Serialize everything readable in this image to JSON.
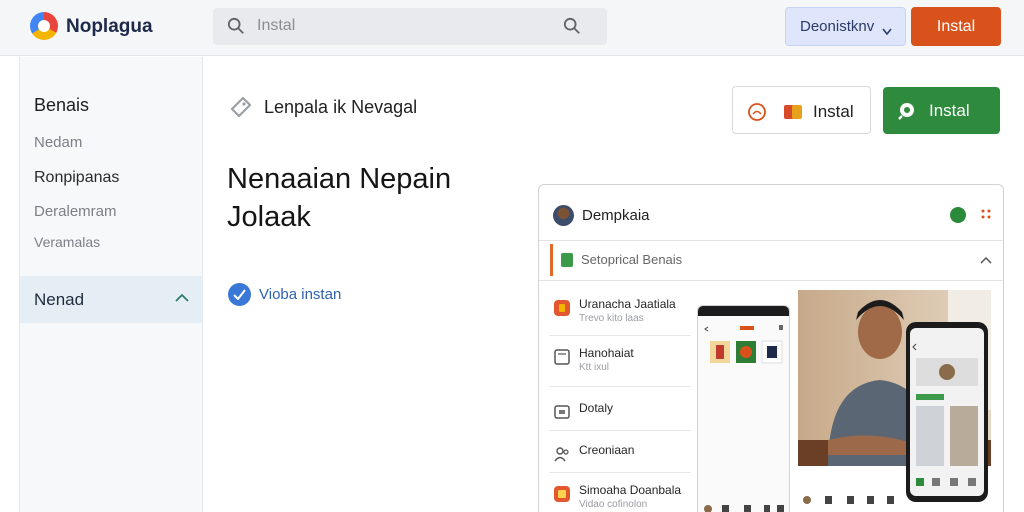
{
  "header": {
    "app_name": "Noplagua",
    "search_placeholder": "Instal",
    "secondary_button": "Deonistknv",
    "primary_button": "Instal"
  },
  "sidebar": {
    "items": [
      {
        "label": "Benais"
      },
      {
        "label": "Nedam"
      },
      {
        "label": "Ronpipanas"
      },
      {
        "label": "Deralemram"
      },
      {
        "label": "Veramalas"
      }
    ],
    "active_item": "Nenad"
  },
  "main": {
    "breadcrumb": "Lenpala ik Nevagal",
    "headline": "Nenaaian Nepain Jolaak",
    "check_label": "Vioba instan",
    "outline_button": "Instal",
    "green_button": "Instal"
  },
  "card": {
    "title": "Dempkaia",
    "section_label": "Setoprical Benais",
    "list": [
      {
        "title": "Uranacha Jaatiala",
        "subtitle": "Trevo kito laas"
      },
      {
        "title": "Hanohaiat",
        "subtitle": "Ktt ixul"
      },
      {
        "title": "Dotaly",
        "subtitle": ""
      },
      {
        "title": "Creoniaan",
        "subtitle": ""
      },
      {
        "title": "Simoaha Doanbala",
        "subtitle": "Vidao cofinolon"
      }
    ]
  },
  "colors": {
    "primary_orange": "#d9521b",
    "green": "#2e8b3e",
    "accent_blue": "#3a78d8",
    "secondary_bg": "#dfe6fb"
  }
}
